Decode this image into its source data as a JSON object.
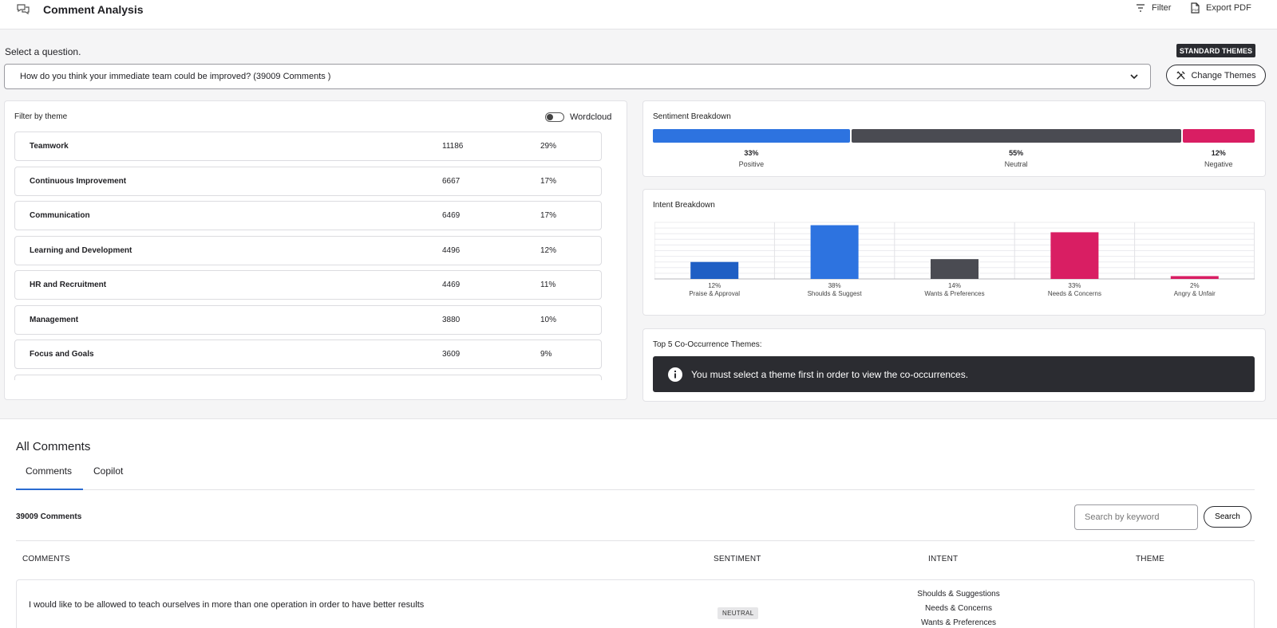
{
  "header": {
    "title": "Comment Analysis",
    "filter_label": "Filter",
    "export_label": "Export PDF"
  },
  "question": {
    "label": "Select a question.",
    "badge": "STANDARD THEMES",
    "selected": "How do you think your immediate team could be improved? (39009 Comments )",
    "change_themes_label": "Change Themes"
  },
  "filter_panel": {
    "title": "Filter by theme",
    "wordcloud_label": "Wordcloud",
    "themes": [
      {
        "name": "Teamwork",
        "count": "11186",
        "pct": "29%"
      },
      {
        "name": "Continuous Improvement",
        "count": "6667",
        "pct": "17%"
      },
      {
        "name": "Communication",
        "count": "6469",
        "pct": "17%"
      },
      {
        "name": "Learning and Development",
        "count": "4496",
        "pct": "12%"
      },
      {
        "name": "HR and Recruitment",
        "count": "4469",
        "pct": "11%"
      },
      {
        "name": "Management",
        "count": "3880",
        "pct": "10%"
      },
      {
        "name": "Focus and Goals",
        "count": "3609",
        "pct": "9%"
      },
      {
        "name": "",
        "count": "",
        "pct": ""
      }
    ]
  },
  "sentiment": {
    "title": "Sentiment Breakdown",
    "items": [
      {
        "label": "Positive",
        "pct_text": "33%",
        "value": 33,
        "color": "#2d73e0"
      },
      {
        "label": "Neutral",
        "pct_text": "55%",
        "value": 55,
        "color": "#4a4b52"
      },
      {
        "label": "Negative",
        "pct_text": "12%",
        "value": 12,
        "color": "#d91e63"
      }
    ]
  },
  "chart_data": {
    "type": "bar",
    "title": "Intent Breakdown",
    "categories": [
      "Praise & Approval",
      "Shoulds & Suggest",
      "Wants & Preferences",
      "Needs & Concerns",
      "Angry & Unfair"
    ],
    "values": [
      12,
      38,
      14,
      33,
      2
    ],
    "value_labels": [
      "12%",
      "38%",
      "14%",
      "33%",
      "2%"
    ],
    "colors": [
      "#1f5fc4",
      "#2d73e0",
      "#4a4b52",
      "#d91e63",
      "#d91e63"
    ],
    "ylim": [
      0,
      40
    ],
    "grid": true
  },
  "cooccurrence": {
    "title": "Top 5 Co-Occurrence Themes:",
    "message": "You must select a theme first in order to view the co-occurrences."
  },
  "comments": {
    "title": "All Comments",
    "tabs": [
      "Comments",
      "Copilot"
    ],
    "count_label": "39009 Comments",
    "search_placeholder": "Search by keyword",
    "search_button": "Search",
    "columns": [
      "COMMENTS",
      "SENTIMENT",
      "INTENT",
      "THEME"
    ],
    "rows": [
      {
        "comment": "I would like to be allowed to teach ourselves in more than one operation in order to have better results",
        "sentiment": "NEUTRAL",
        "intents": [
          "Shoulds & Suggestions",
          "Needs & Concerns",
          "Wants & Preferences"
        ]
      }
    ]
  }
}
